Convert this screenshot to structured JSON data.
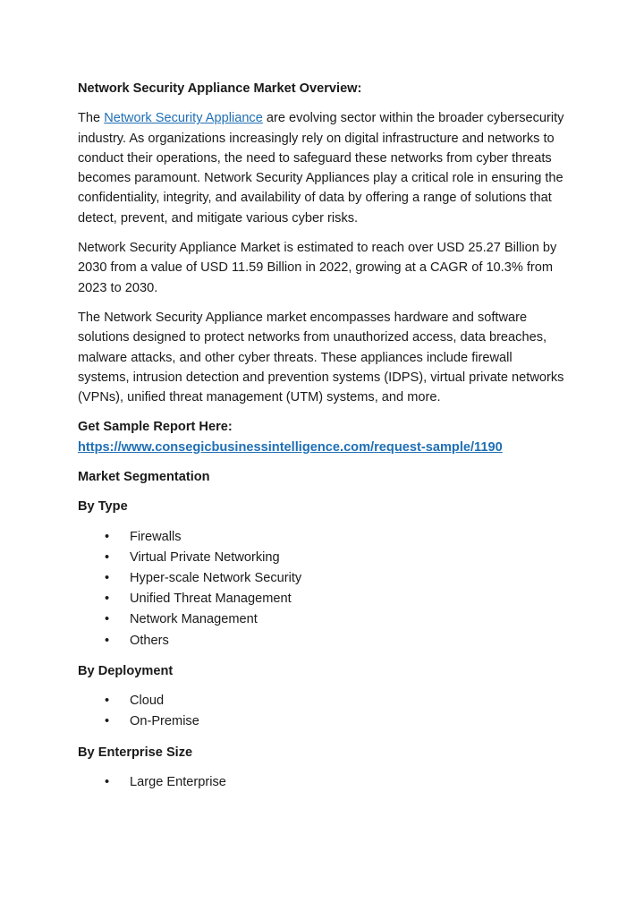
{
  "document": {
    "heading": "Network Security Appliance Market Overview:",
    "paragraphs": {
      "intro_before_link": "The ",
      "intro_link_text": "Network Security Appliance",
      "intro_after_link": " are evolving sector within the broader cybersecurity industry. As organizations increasingly rely on digital infrastructure and networks to conduct their operations, the need to safeguard these networks from cyber threats becomes paramount. Network Security Appliances play a critical role in ensuring the confidentiality, integrity, and availability of data by offering a range of solutions that detect, prevent, and mitigate various cyber risks.",
      "market_value": "Network Security Appliance Market is estimated to reach over USD 25.27 Billion by 2030 from a value of USD 11.59 Billion in 2022, growing at a CAGR of 10.3% from 2023 to 2030.",
      "scope": "The Network Security Appliance market encompasses hardware and software solutions designed to protect networks from unauthorized access, data breaches, malware attacks, and other cyber threats. These appliances include firewall systems, intrusion detection and prevention systems (IDPS), virtual private networks (VPNs), unified threat management (UTM) systems, and more."
    },
    "sample_report": {
      "label": "Get Sample Report Here:",
      "url": "https://www.consegicbusinessintelligence.com/request-sample/1190"
    },
    "segmentation": {
      "title": "Market Segmentation",
      "sections": [
        {
          "heading": "By Type",
          "items": [
            "Firewalls",
            "Virtual Private Networking",
            "Hyper-scale Network Security",
            "Unified Threat Management",
            "Network Management",
            "Others"
          ]
        },
        {
          "heading": "By Deployment",
          "items": [
            "Cloud",
            "On-Premise"
          ]
        },
        {
          "heading": "By Enterprise Size",
          "items": [
            "Large Enterprise"
          ]
        }
      ]
    },
    "colors": {
      "link": "#1f6fb5",
      "text": "#1a1a1a",
      "background": "#ffffff"
    }
  }
}
